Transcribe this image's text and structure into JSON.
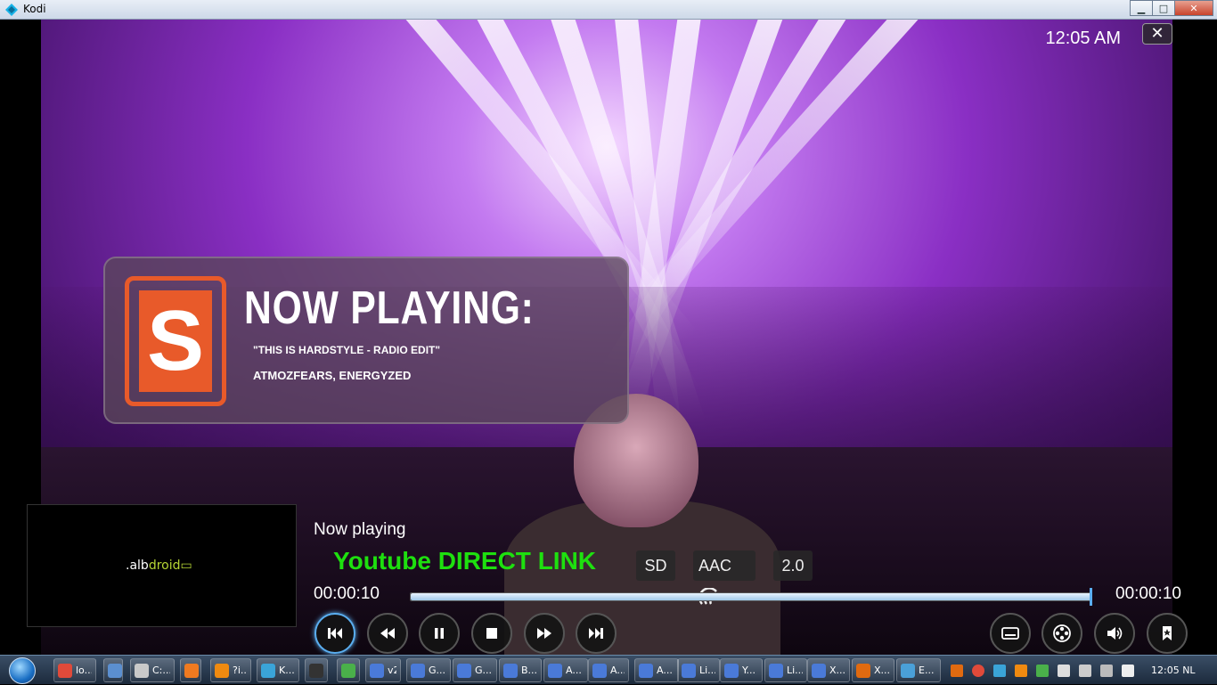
{
  "window": {
    "title": "Kodi",
    "minimize_icon": "minimize-icon",
    "maximize_icon": "maximize-icon",
    "close_icon": "close-icon"
  },
  "osd": {
    "clock": "12:05 AM",
    "close_glyph": "✕",
    "banner": {
      "logo_letter": "S",
      "heading": "NOW PLAYING:",
      "track": "\"THIS IS HARDSTYLE - RADIO EDIT\"",
      "artist": "ATMOZFEARS, ENERGYZED"
    },
    "thumbnail": {
      "brand_prefix": ".alb",
      "brand_suffix": "droid"
    },
    "now_playing_label": "Now playing",
    "title": "Youtube DIRECT LINK",
    "flags": {
      "video": "SD",
      "audio": "AAC",
      "channels": "2.0"
    },
    "time_elapsed": "00:00:10",
    "time_total": "00:00:10",
    "progress": 1.0,
    "controls": [
      {
        "name": "previous-button",
        "icon": "skip-back-icon",
        "active": true
      },
      {
        "name": "rewind-button",
        "icon": "rewind-icon",
        "active": false
      },
      {
        "name": "pause-button",
        "icon": "pause-icon",
        "active": false
      },
      {
        "name": "stop-button",
        "icon": "stop-icon",
        "active": false
      },
      {
        "name": "fast-forward-button",
        "icon": "fast-forward-icon",
        "active": false
      },
      {
        "name": "next-button",
        "icon": "skip-forward-icon",
        "active": false
      }
    ],
    "right_controls": [
      {
        "name": "subtitles-button",
        "icon": "subtitles-icon"
      },
      {
        "name": "video-settings-button",
        "icon": "film-reel-icon"
      },
      {
        "name": "audio-settings-button",
        "icon": "speaker-icon"
      },
      {
        "name": "bookmark-button",
        "icon": "bookmark-icon"
      }
    ]
  },
  "taskbar": {
    "items": [
      {
        "label": "lo...",
        "color": "#e04a3a"
      },
      {
        "label": "",
        "color": "#5b8fd0"
      },
      {
        "label": "C:...",
        "color": "#c9c9c9"
      },
      {
        "label": "",
        "color": "#f07a20"
      },
      {
        "label": "?i...",
        "color": "#f08a10"
      },
      {
        "label": "K...",
        "color": "#3aa4d8"
      },
      {
        "label": "",
        "color": "#333"
      },
      {
        "label": "",
        "color": "#4ab04a"
      },
      {
        "label": "v2",
        "color": "#4a7ad8"
      },
      {
        "label": "G...",
        "color": "#4a7ad8"
      },
      {
        "label": "G...",
        "color": "#4a7ad8"
      },
      {
        "label": "B...",
        "color": "#4a7ad8"
      },
      {
        "label": "A...",
        "color": "#4a7ad8"
      },
      {
        "label": "A...",
        "color": "#4a7ad8"
      },
      {
        "label": "A...",
        "color": "#4a7ad8"
      },
      {
        "label": "Li...",
        "color": "#4a7ad8"
      },
      {
        "label": "Y...",
        "color": "#4a7ad8"
      },
      {
        "label": "Li...",
        "color": "#4a7ad8"
      },
      {
        "label": "X...",
        "color": "#4a7ad8"
      },
      {
        "label": "X...",
        "color": "#e06a10"
      },
      {
        "label": "E...",
        "color": "#4aa0d8"
      }
    ],
    "clock": "12:05 NL"
  }
}
